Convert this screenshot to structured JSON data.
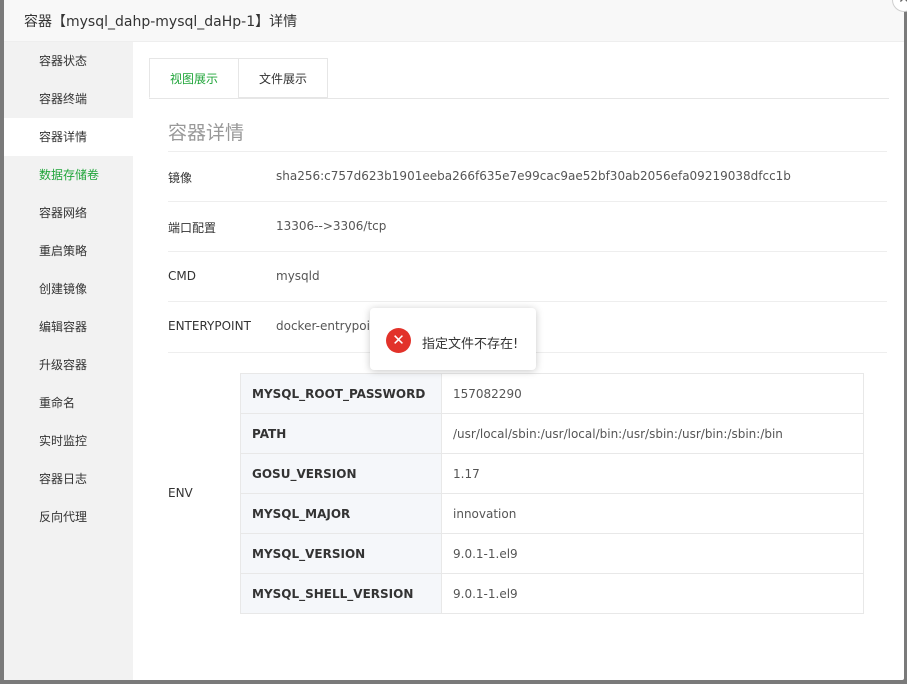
{
  "dialog": {
    "title": "容器【mysql_dahp-mysql_daHp-1】详情",
    "close_glyph": "✕"
  },
  "sidebar": {
    "items": [
      {
        "label": "容器状态"
      },
      {
        "label": "容器终端"
      },
      {
        "label": "容器详情"
      },
      {
        "label": "数据存储卷"
      },
      {
        "label": "容器网络"
      },
      {
        "label": "重启策略"
      },
      {
        "label": "创建镜像"
      },
      {
        "label": "编辑容器"
      },
      {
        "label": "升级容器"
      },
      {
        "label": "重命名"
      },
      {
        "label": "实时监控"
      },
      {
        "label": "容器日志"
      },
      {
        "label": "反向代理"
      }
    ]
  },
  "tabs": [
    {
      "label": "视图展示"
    },
    {
      "label": "文件展示"
    }
  ],
  "details": {
    "section_title": "容器详情",
    "image_label": "镜像",
    "image_value": "sha256:c757d623b1901eeba266f635e7e99cac9ae52bf30ab2056efa09219038dfcc1b",
    "port_label": "端口配置",
    "port_value": "13306-->3306/tcp",
    "cmd_label": "CMD",
    "cmd_value": "mysqld",
    "entrypoint_label": "ENTERYPOINT",
    "entrypoint_value": "docker-entrypoint.sh",
    "env_label": "ENV",
    "env": [
      {
        "key": "MYSQL_ROOT_PASSWORD",
        "value": "157082290"
      },
      {
        "key": "PATH",
        "value": "/usr/local/sbin:/usr/local/bin:/usr/sbin:/usr/bin:/sbin:/bin"
      },
      {
        "key": "GOSU_VERSION",
        "value": "1.17"
      },
      {
        "key": "MYSQL_MAJOR",
        "value": "innovation"
      },
      {
        "key": "MYSQL_VERSION",
        "value": "9.0.1-1.el9"
      },
      {
        "key": "MYSQL_SHELL_VERSION",
        "value": "9.0.1-1.el9"
      }
    ]
  },
  "toast": {
    "icon_glyph": "✕",
    "message": "指定文件不存在!"
  },
  "colors": {
    "accent": "#20a53a",
    "error": "#e2322a"
  }
}
